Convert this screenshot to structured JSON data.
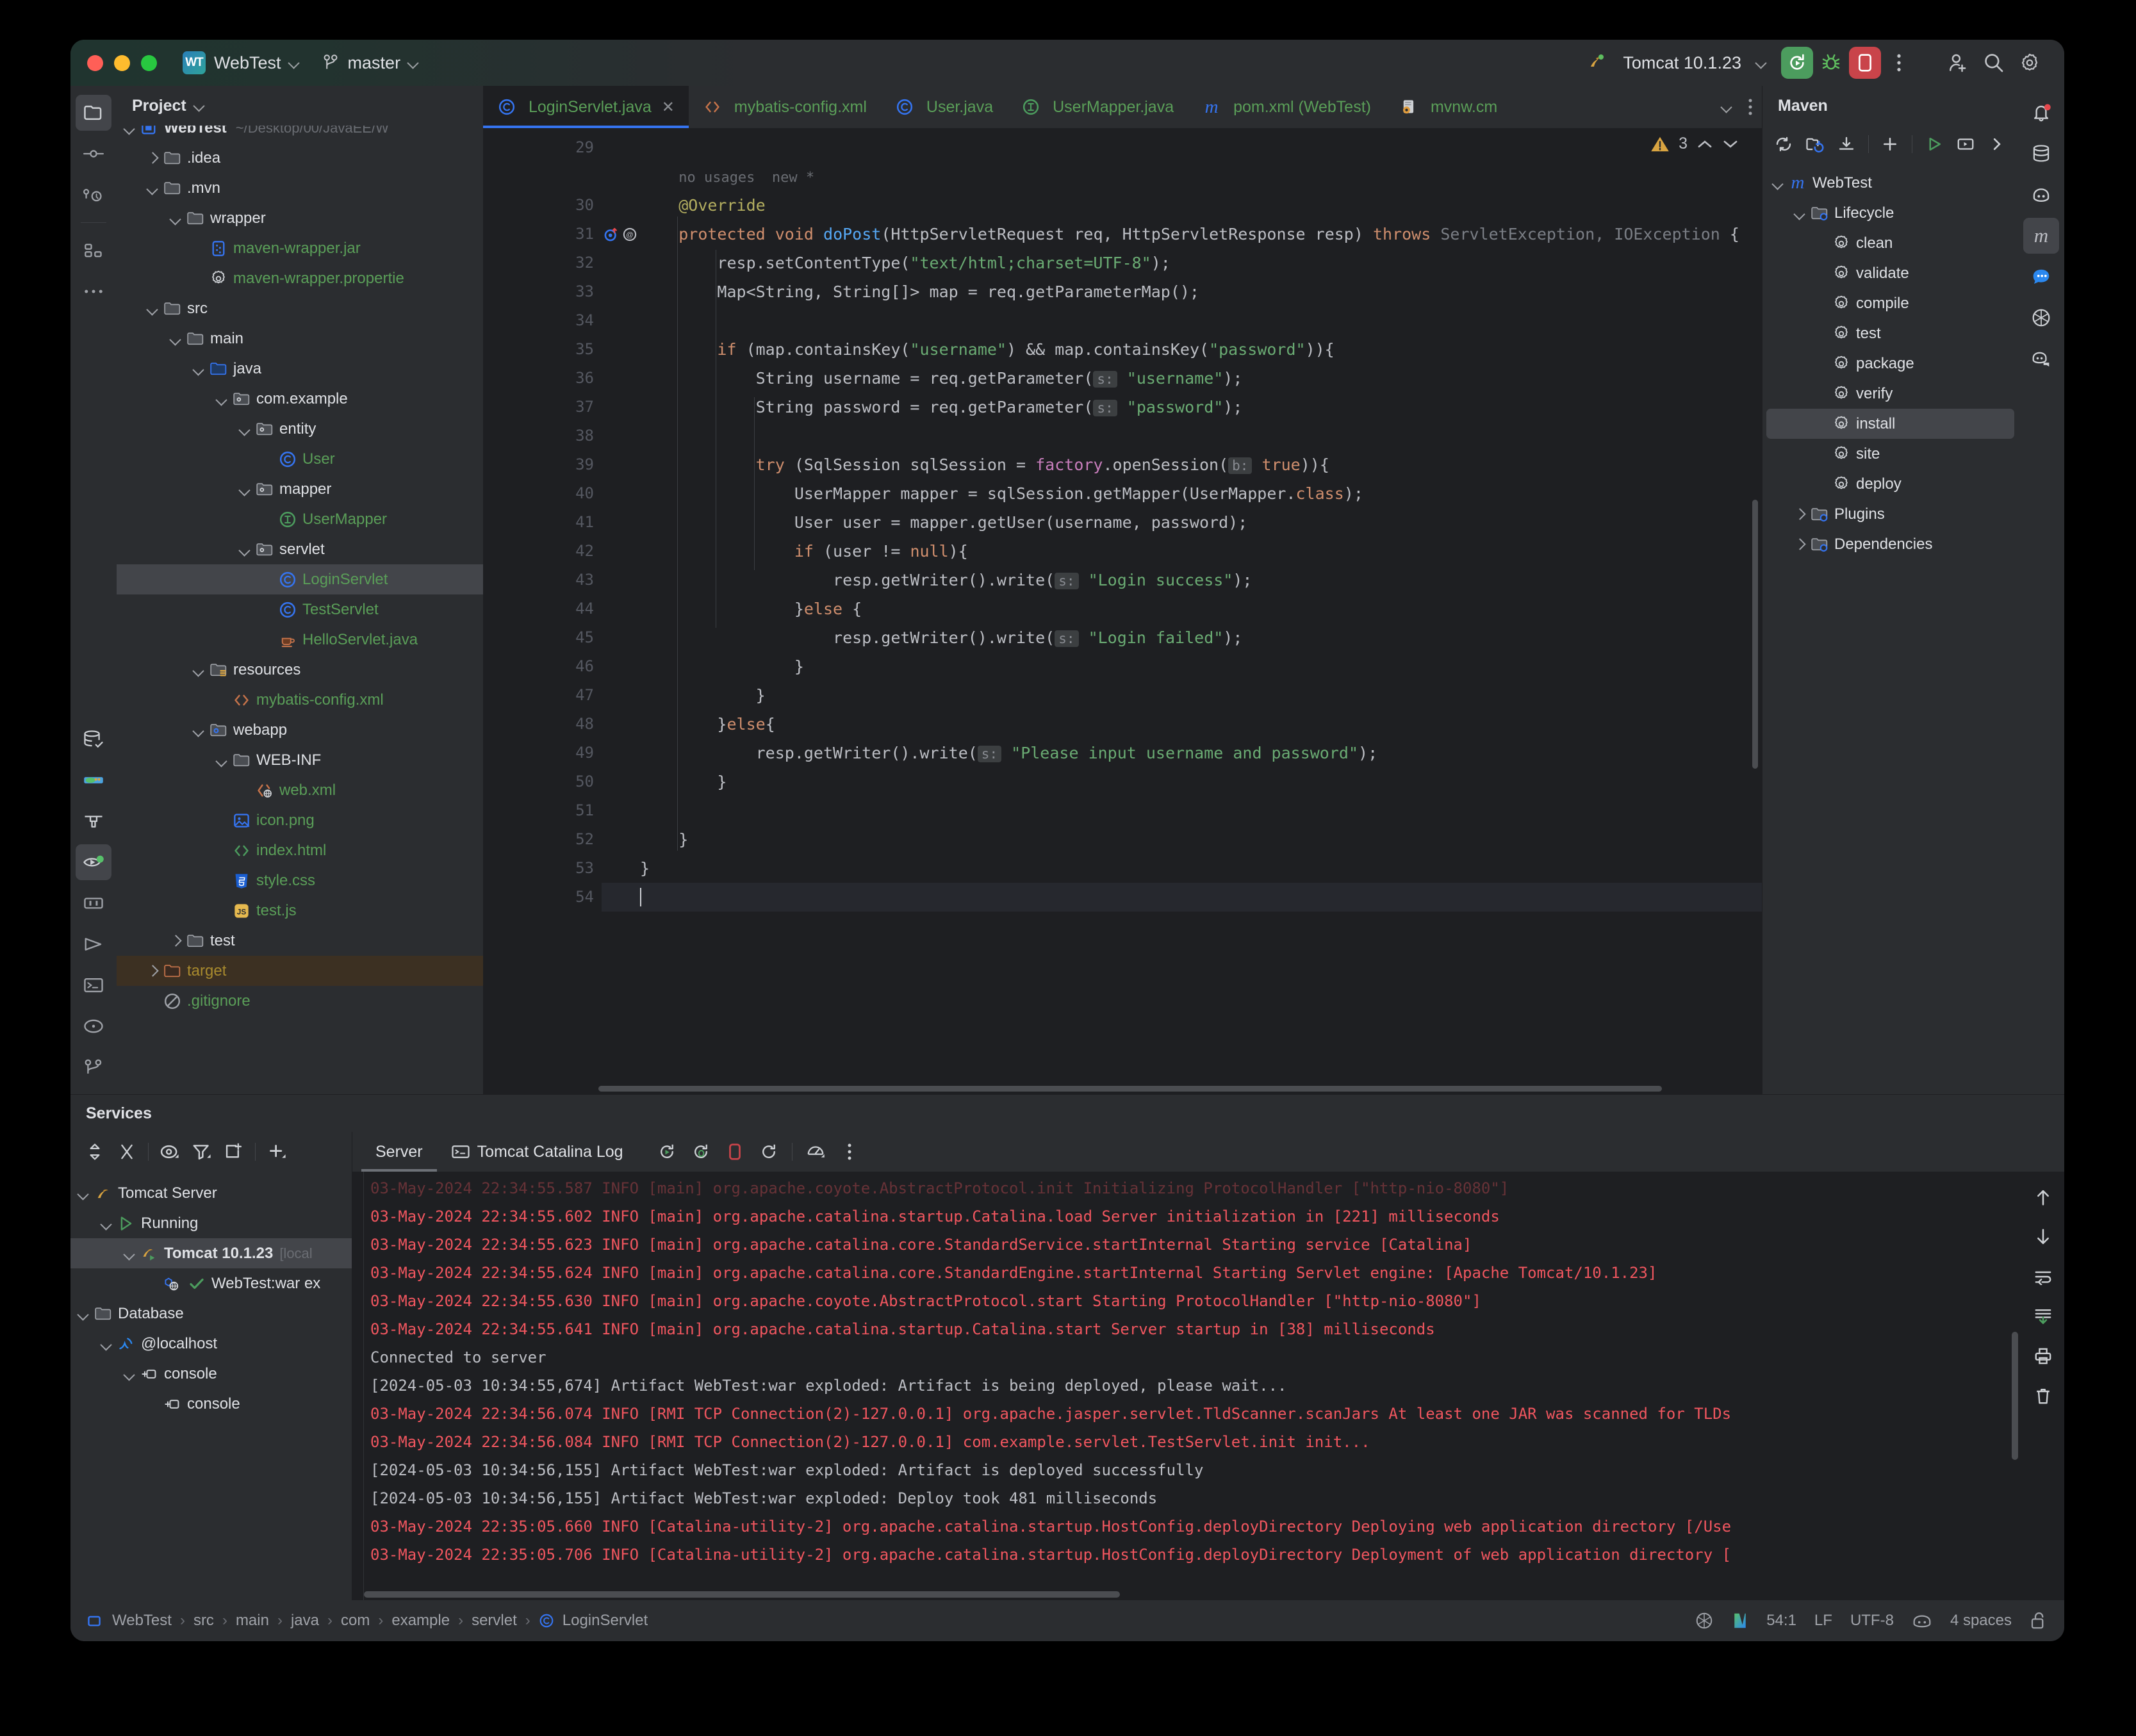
{
  "titlebar": {
    "project_badge": "WT",
    "project_name": "WebTest",
    "branch": "master",
    "run_config": "Tomcat 10.1.23"
  },
  "project_panel": {
    "title": "Project",
    "tree": [
      {
        "label": "WebTest",
        "path": "~/Desktop/00/JavaEE/W",
        "indent": 0,
        "icon": "module-icon",
        "color": "bold",
        "arrow": "down",
        "clipped": true
      },
      {
        "label": ".idea",
        "indent": 1,
        "icon": "folder-icon",
        "arrow": "right"
      },
      {
        "label": ".mvn",
        "indent": 1,
        "icon": "folder-icon",
        "arrow": "down"
      },
      {
        "label": "wrapper",
        "indent": 2,
        "icon": "folder-icon",
        "arrow": "down"
      },
      {
        "label": "maven-wrapper.jar",
        "indent": 3,
        "icon": "jar-icon",
        "color": "green"
      },
      {
        "label": "maven-wrapper.propertie",
        "indent": 3,
        "icon": "properties-icon",
        "color": "green"
      },
      {
        "label": "src",
        "indent": 1,
        "icon": "folder-icon",
        "arrow": "down"
      },
      {
        "label": "main",
        "indent": 2,
        "icon": "folder-icon",
        "arrow": "down"
      },
      {
        "label": "java",
        "indent": 3,
        "icon": "source-root-icon",
        "arrow": "down"
      },
      {
        "label": "com.example",
        "indent": 4,
        "icon": "package-icon",
        "arrow": "down"
      },
      {
        "label": "entity",
        "indent": 5,
        "icon": "package-icon",
        "arrow": "down"
      },
      {
        "label": "User",
        "indent": 6,
        "icon": "class-icon",
        "color": "green"
      },
      {
        "label": "mapper",
        "indent": 5,
        "icon": "package-icon",
        "arrow": "down"
      },
      {
        "label": "UserMapper",
        "indent": 6,
        "icon": "interface-icon",
        "color": "green"
      },
      {
        "label": "servlet",
        "indent": 5,
        "icon": "package-icon",
        "arrow": "down"
      },
      {
        "label": "LoginServlet",
        "indent": 6,
        "icon": "class-icon",
        "color": "green",
        "selected": true
      },
      {
        "label": "TestServlet",
        "indent": 6,
        "icon": "class-icon",
        "color": "green"
      },
      {
        "label": "HelloServlet.java",
        "indent": 6,
        "icon": "java-file-icon",
        "color": "green"
      },
      {
        "label": "resources",
        "indent": 3,
        "icon": "resource-root-icon",
        "arrow": "down"
      },
      {
        "label": "mybatis-config.xml",
        "indent": 4,
        "icon": "xml-icon",
        "color": "green"
      },
      {
        "label": "webapp",
        "indent": 3,
        "icon": "webapp-root-icon",
        "arrow": "down"
      },
      {
        "label": "WEB-INF",
        "indent": 4,
        "icon": "folder-icon",
        "arrow": "down"
      },
      {
        "label": "web.xml",
        "indent": 5,
        "icon": "web-xml-icon",
        "color": "green"
      },
      {
        "label": "icon.png",
        "indent": 4,
        "icon": "image-icon",
        "color": "green"
      },
      {
        "label": "index.html",
        "indent": 4,
        "icon": "html-icon",
        "color": "green"
      },
      {
        "label": "style.css",
        "indent": 4,
        "icon": "css-icon",
        "color": "green"
      },
      {
        "label": "test.js",
        "indent": 4,
        "icon": "js-icon",
        "color": "green"
      },
      {
        "label": "test",
        "indent": 2,
        "icon": "folder-icon",
        "arrow": "right"
      },
      {
        "label": "target",
        "indent": 1,
        "icon": "excluded-folder-icon",
        "color": "yellow",
        "arrow": "right",
        "highlight": "target"
      },
      {
        "label": ".gitignore",
        "indent": 1,
        "icon": "gitignore-icon",
        "color": "green"
      }
    ]
  },
  "editor": {
    "tabs": [
      {
        "label": "LoginServlet.java",
        "icon": "class-icon",
        "active": true,
        "closable": true
      },
      {
        "label": "mybatis-config.xml",
        "icon": "xml-icon",
        "active": false
      },
      {
        "label": "User.java",
        "icon": "class-icon",
        "active": false
      },
      {
        "label": "UserMapper.java",
        "icon": "interface-icon",
        "active": false
      },
      {
        "label": "pom.xml (WebTest)",
        "icon": "maven-icon",
        "active": false
      },
      {
        "label": "mvnw.cm",
        "icon": "script-icon",
        "active": false
      }
    ],
    "inspection": {
      "warning_count": "3",
      "icon": "warning-icon"
    },
    "caret_line": 54,
    "first_line": 29,
    "gutter_hint": "no usages  new *",
    "lines": [
      {
        "n": 29,
        "html": ""
      },
      {
        "n": null,
        "html": "<span class=\"inlay\">no usages  new *</span>",
        "indent": "    "
      },
      {
        "n": 30,
        "html": "    <span class=\"ann\">@Override</span>"
      },
      {
        "n": 31,
        "html": "    <span class=\"kw\">protected</span> <span class=\"kw\">void</span> <span class=\"mth\">doPost</span>(HttpServletRequest req, HttpServletResponse resp) <span class=\"kw\">throws</span> <span class=\"cmt\">ServletException, IOException</span> {",
        "marks": "override-implement"
      },
      {
        "n": 32,
        "html": "        resp.setContentType(<span class=\"str\">\"text/html;charset=UTF-8\"</span>);"
      },
      {
        "n": 33,
        "html": "        Map&lt;String, String[]&gt; map = req.getParameterMap();"
      },
      {
        "n": 34,
        "html": ""
      },
      {
        "n": 35,
        "html": "        <span class=\"kw\">if</span> (map.containsKey(<span class=\"str\">\"username\"</span>) &amp;&amp; map.containsKey(<span class=\"str\">\"password\"</span>)){"
      },
      {
        "n": 36,
        "html": "            String username = req.getParameter(<span class=\"hint\">s:</span> <span class=\"str\">\"username\"</span>);"
      },
      {
        "n": 37,
        "html": "            String password = req.getParameter(<span class=\"hint\">s:</span> <span class=\"str\">\"password\"</span>);"
      },
      {
        "n": 38,
        "html": ""
      },
      {
        "n": 39,
        "html": "            <span class=\"kw\">try</span> (SqlSession sqlSession = <span class=\"fld\">factory</span>.openSession(<span class=\"hint\">b:</span> <span class=\"kw\">true</span>)){"
      },
      {
        "n": 40,
        "html": "                UserMapper mapper = sqlSession.getMapper(UserMapper.<span class=\"kw\">class</span>);"
      },
      {
        "n": 41,
        "html": "                User user = mapper.getUser(username, password);"
      },
      {
        "n": 42,
        "html": "                <span class=\"kw\">if</span> (user != <span class=\"kw\">null</span>){"
      },
      {
        "n": 43,
        "html": "                    resp.getWriter().write(<span class=\"hint\">s:</span> <span class=\"str\">\"Login success\"</span>);"
      },
      {
        "n": 44,
        "html": "                }<span class=\"kw\">else</span> {"
      },
      {
        "n": 45,
        "html": "                    resp.getWriter().write(<span class=\"hint\">s:</span> <span class=\"str\">\"Login failed\"</span>);"
      },
      {
        "n": 46,
        "html": "                }"
      },
      {
        "n": 47,
        "html": "            }"
      },
      {
        "n": 48,
        "html": "        }<span class=\"kw\">else</span>{"
      },
      {
        "n": 49,
        "html": "            resp.getWriter().write(<span class=\"hint\">s:</span> <span class=\"str\">\"Please input username and password\"</span>);"
      },
      {
        "n": 50,
        "html": "        }"
      },
      {
        "n": 51,
        "html": ""
      },
      {
        "n": 52,
        "html": "    }"
      },
      {
        "n": 53,
        "html": "}"
      },
      {
        "n": 54,
        "html": "",
        "caret": true
      }
    ]
  },
  "maven": {
    "title": "Maven",
    "toolbar_icons": [
      "reload-icon",
      "reimport-icon",
      "download-sources-icon",
      "add-icon",
      "run-icon",
      "execute-goal-icon",
      "more-icon"
    ],
    "tree": [
      {
        "label": "WebTest",
        "indent": 0,
        "icon": "maven-icon",
        "arrow": "down"
      },
      {
        "label": "Lifecycle",
        "indent": 1,
        "icon": "lifecycle-folder-icon",
        "arrow": "down"
      },
      {
        "label": "clean",
        "indent": 2,
        "icon": "goal-icon"
      },
      {
        "label": "validate",
        "indent": 2,
        "icon": "goal-icon"
      },
      {
        "label": "compile",
        "indent": 2,
        "icon": "goal-icon"
      },
      {
        "label": "test",
        "indent": 2,
        "icon": "goal-icon"
      },
      {
        "label": "package",
        "indent": 2,
        "icon": "goal-icon"
      },
      {
        "label": "verify",
        "indent": 2,
        "icon": "goal-icon"
      },
      {
        "label": "install",
        "indent": 2,
        "icon": "goal-icon",
        "selected": true
      },
      {
        "label": "site",
        "indent": 2,
        "icon": "goal-icon"
      },
      {
        "label": "deploy",
        "indent": 2,
        "icon": "goal-icon"
      },
      {
        "label": "Plugins",
        "indent": 1,
        "icon": "plugins-folder-icon",
        "arrow": "right"
      },
      {
        "label": "Dependencies",
        "indent": 1,
        "icon": "deps-folder-icon",
        "arrow": "right"
      }
    ]
  },
  "services": {
    "title": "Services",
    "toolbar_icons": [
      "expand-collapse-icon",
      "collapse-all-icon",
      "show-icon",
      "filter-icon",
      "new-tab-icon",
      "add-icon"
    ],
    "tree": [
      {
        "label": "Tomcat Server",
        "indent": 0,
        "icon": "tomcat-icon",
        "arrow": "down"
      },
      {
        "label": "Running",
        "indent": 1,
        "icon": "run-icon",
        "arrow": "down"
      },
      {
        "label": "Tomcat 10.1.23",
        "suffix": "[local",
        "indent": 2,
        "icon": "tomcat-run-icon",
        "arrow": "down",
        "selected": true,
        "bold": true
      },
      {
        "label": "WebTest:war ex",
        "indent": 3,
        "icon": "artifact-icon",
        "check": true
      },
      {
        "label": "Database",
        "indent": 0,
        "icon": "folder-icon",
        "arrow": "down"
      },
      {
        "label": "@localhost",
        "indent": 1,
        "icon": "mysql-icon",
        "arrow": "down"
      },
      {
        "label": "console",
        "indent": 2,
        "icon": "console-icon",
        "arrow": "down"
      },
      {
        "label": "console",
        "indent": 3,
        "icon": "console-icon"
      }
    ],
    "tabs": [
      {
        "label": "Server",
        "active": true
      },
      {
        "label": "Tomcat Catalina Log",
        "icon": "terminal-icon",
        "active": false
      }
    ],
    "tab_tools": [
      "rerun-icon",
      "rerun-debug-icon",
      "stop-icon",
      "restart-icon",
      "more-icon",
      "settings-icon"
    ],
    "side_icons": [
      "up-icon",
      "down-icon",
      "soft-wrap-icon",
      "scroll-to-end-icon",
      "print-icon",
      "clear-all-icon"
    ],
    "log": [
      {
        "text": "03-May-2024 22:34:55.587 INFO [main] org.apache.coyote.AbstractProtocol.init Initializing ProtocolHandler [\"http-nio-8080\"]",
        "type": "err",
        "fade": true
      },
      {
        "text": "03-May-2024 22:34:55.602 INFO [main] org.apache.catalina.startup.Catalina.load Server initialization in [221] milliseconds",
        "type": "err"
      },
      {
        "text": "03-May-2024 22:34:55.623 INFO [main] org.apache.catalina.core.StandardService.startInternal Starting service [Catalina]",
        "type": "err"
      },
      {
        "text": "03-May-2024 22:34:55.624 INFO [main] org.apache.catalina.core.StandardEngine.startInternal Starting Servlet engine: [Apache Tomcat/10.1.23]",
        "type": "err"
      },
      {
        "text": "03-May-2024 22:34:55.630 INFO [main] org.apache.coyote.AbstractProtocol.start Starting ProtocolHandler [\"http-nio-8080\"]",
        "type": "err"
      },
      {
        "text": "03-May-2024 22:34:55.641 INFO [main] org.apache.catalina.startup.Catalina.start Server startup in [38] milliseconds",
        "type": "err"
      },
      {
        "text": "Connected to server",
        "type": "out"
      },
      {
        "text": "[2024-05-03 10:34:55,674] Artifact WebTest:war exploded: Artifact is being deployed, please wait...",
        "type": "out"
      },
      {
        "text": "03-May-2024 22:34:56.074 INFO [RMI TCP Connection(2)-127.0.0.1] org.apache.jasper.servlet.TldScanner.scanJars At least one JAR was scanned for TLDs",
        "type": "err"
      },
      {
        "text": "03-May-2024 22:34:56.084 INFO [RMI TCP Connection(2)-127.0.0.1] com.example.servlet.TestServlet.init init...",
        "type": "err"
      },
      {
        "text": "[2024-05-03 10:34:56,155] Artifact WebTest:war exploded: Artifact is deployed successfully",
        "type": "out"
      },
      {
        "text": "[2024-05-03 10:34:56,155] Artifact WebTest:war exploded: Deploy took 481 milliseconds",
        "type": "out"
      },
      {
        "text": "03-May-2024 22:35:05.660 INFO [Catalina-utility-2] org.apache.catalina.startup.HostConfig.deployDirectory Deploying web application directory [/Use",
        "type": "err"
      },
      {
        "text": "03-May-2024 22:35:05.706 INFO [Catalina-utility-2] org.apache.catalina.startup.HostConfig.deployDirectory Deployment of web application directory [",
        "type": "err"
      }
    ]
  },
  "status_bar": {
    "breadcrumb": [
      "WebTest",
      "src",
      "main",
      "java",
      "com",
      "example",
      "servlet",
      "LoginServlet"
    ],
    "position": "54:1",
    "line_separator": "LF",
    "encoding": "UTF-8",
    "indent": "4 spaces",
    "right_icons": [
      "openai-icon",
      "idea-vim-icon",
      "copilot-icon",
      "lock-icon"
    ]
  },
  "left_rail": {
    "top": [
      "project-icon",
      "commit-icon",
      "pull-requests-icon",
      "structure-icon",
      "more-tools-icon"
    ],
    "bottom": [
      "database-icon",
      "services-icon",
      "build-icon",
      "run-debug-icon",
      "debug-icon",
      "run-icon",
      "terminal-icon",
      "problems-icon",
      "git-icon"
    ]
  },
  "right_rail": {
    "icons": [
      "notifications-icon",
      "database-icon",
      "copilot-icon",
      "maven-icon",
      "chat-icon",
      "openai-icon",
      "ai-assistant-icon"
    ]
  },
  "colors": {
    "accent": "#3574f0",
    "run_green": "#4c9c5e",
    "stop_red": "#c9444a",
    "string_green": "#6aab73",
    "keyword_orange": "#cf8e6d",
    "log_error": "#f0565f"
  }
}
